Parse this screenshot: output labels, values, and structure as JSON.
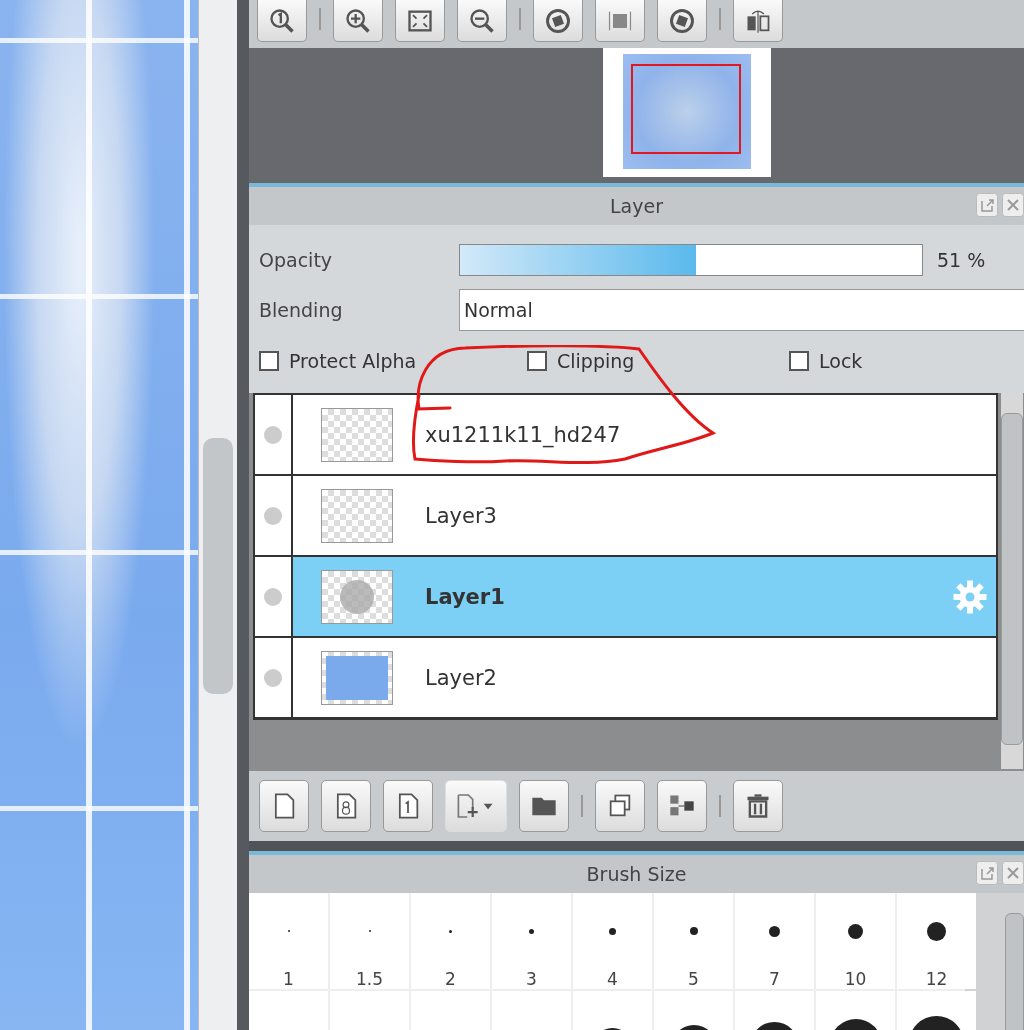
{
  "layer_panel": {
    "title": "Layer",
    "opacity": {
      "label": "Opacity",
      "level": 0.51,
      "reading": "51 %"
    },
    "blending": {
      "label": "Blending",
      "value": "Normal"
    },
    "options": [
      {
        "label": "Protect Alpha",
        "checked": false
      },
      {
        "label": "Clipping",
        "checked": false
      },
      {
        "label": "Lock",
        "checked": false
      }
    ],
    "layers": [
      {
        "name": "xu1211k11_hd247",
        "kind": "empty",
        "selected": false
      },
      {
        "name": "Layer3",
        "kind": "empty",
        "selected": false
      },
      {
        "name": "Layer1",
        "kind": "circle",
        "selected": true
      },
      {
        "name": "Layer2",
        "kind": "image",
        "selected": false
      }
    ]
  },
  "brush_panel": {
    "title": "Brush Size",
    "sizes": [
      "1",
      "1.5",
      "2",
      "3",
      "4",
      "5",
      "7",
      "10",
      "12"
    ]
  }
}
